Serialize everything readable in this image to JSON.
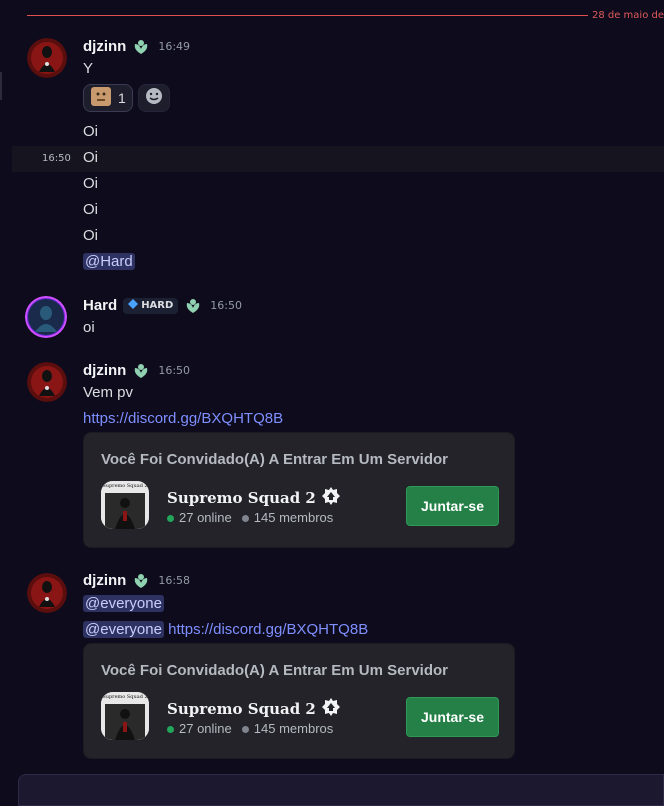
{
  "date_divider": "28 de maio de",
  "messages": [
    {
      "user": "djzinn",
      "time": "16:49",
      "lines": [
        "Y"
      ],
      "reaction": {
        "count": "1"
      },
      "more_lines": [
        "Oi",
        "Oi",
        "Oi",
        "Oi",
        "Oi"
      ],
      "hover_time": "16:50",
      "mention": "@Hard"
    },
    {
      "user": "Hard",
      "role_tag": "HARD",
      "time": "16:50",
      "lines": [
        "oi"
      ]
    },
    {
      "user": "djzinn",
      "time": "16:50",
      "lines": [
        "Vem pv"
      ],
      "link": "https://discord.gg/BXQHTQ8B"
    },
    {
      "user": "djzinn",
      "time": "16:58",
      "mention": "@everyone",
      "mention2": "@everyone",
      "link": "https://discord.gg/BXQHTQ8B"
    }
  ],
  "invite": {
    "title": "Você Foi Convidado(A) A Entrar Em Um Servidor",
    "server_name": "Supremo Squad 2",
    "icon_caption": "Supremo Squad 2",
    "online": "27 online",
    "members": "145 membros",
    "join_label": "Juntar-se"
  },
  "colors": {
    "background": "#0d0b1c",
    "divider": "#e05050",
    "link": "#7f8fff",
    "join_button": "#248046",
    "online_dot": "#23a55a",
    "members_dot": "#80848e"
  },
  "icons": [
    "leaf-badge-icon",
    "smiley-add-reaction-icon",
    "verified-flower-icon",
    "diamond-tag-icon"
  ]
}
